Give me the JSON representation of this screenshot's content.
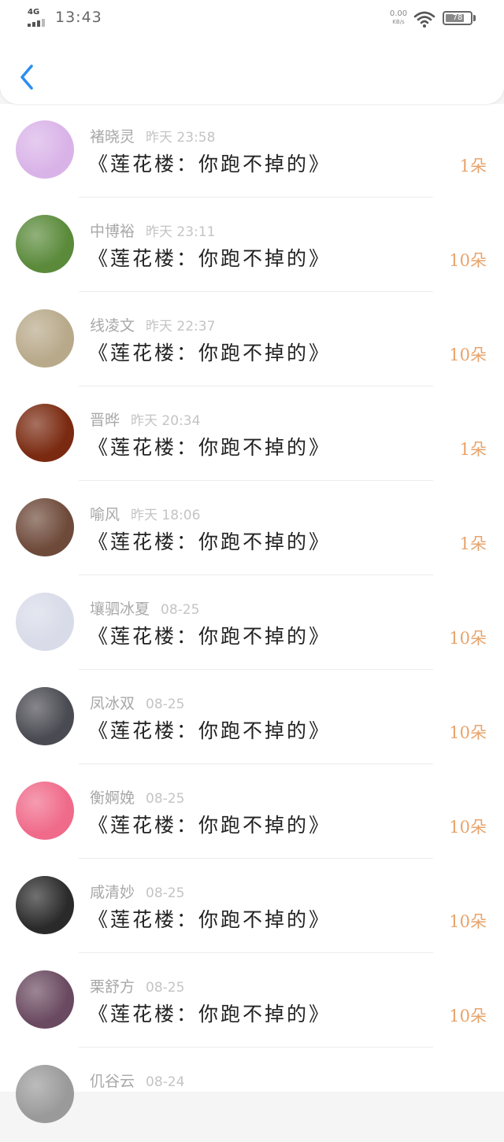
{
  "status_bar": {
    "network": "4G",
    "time": "13:43",
    "speed_value": "0.00",
    "speed_unit": "KB/s",
    "battery": "78",
    "battery_level": 0.78
  },
  "header": {
    "back_icon": "chevron-left-icon",
    "accent_color": "#2c8ff0"
  },
  "list": {
    "items": [
      {
        "name": "褚晓灵",
        "date": "昨天 23:58",
        "title": "《莲花楼：你跑不掉的》",
        "count": "1朵",
        "avatar_color": "#d9b3e8"
      },
      {
        "name": "中博裕",
        "date": "昨天 23:11",
        "title": "《莲花楼：你跑不掉的》",
        "count": "10朵",
        "avatar_color": "#5a8a3a"
      },
      {
        "name": "线凌文",
        "date": "昨天 22:37",
        "title": "《莲花楼：你跑不掉的》",
        "count": "10朵",
        "avatar_color": "#b8a98a"
      },
      {
        "name": "晋晔",
        "date": "昨天 20:34",
        "title": "《莲花楼：你跑不掉的》",
        "count": "1朵",
        "avatar_color": "#7a2a10"
      },
      {
        "name": "喻风",
        "date": "昨天 18:06",
        "title": "《莲花楼：你跑不掉的》",
        "count": "1朵",
        "avatar_color": "#6e4a3a"
      },
      {
        "name": "壤驷冰夏",
        "date": "08-25",
        "title": "《莲花楼：你跑不掉的》",
        "count": "10朵",
        "avatar_color": "#d8dbe8"
      },
      {
        "name": "凤冰双",
        "date": "08-25",
        "title": "《莲花楼：你跑不掉的》",
        "count": "10朵",
        "avatar_color": "#4a4a52"
      },
      {
        "name": "衡婀娩",
        "date": "08-25",
        "title": "《莲花楼：你跑不掉的》",
        "count": "10朵",
        "avatar_color": "#f06a8a"
      },
      {
        "name": "咸清妙",
        "date": "08-25",
        "title": "《莲花楼：你跑不掉的》",
        "count": "10朵",
        "avatar_color": "#2a2a2a"
      },
      {
        "name": "栗舒方",
        "date": "08-25",
        "title": "《莲花楼：你跑不掉的》",
        "count": "10朵",
        "avatar_color": "#6a4a60"
      },
      {
        "name": "仉谷云",
        "date": "08-24",
        "title": "",
        "count": "",
        "avatar_color": "#9a9a9a"
      }
    ]
  }
}
